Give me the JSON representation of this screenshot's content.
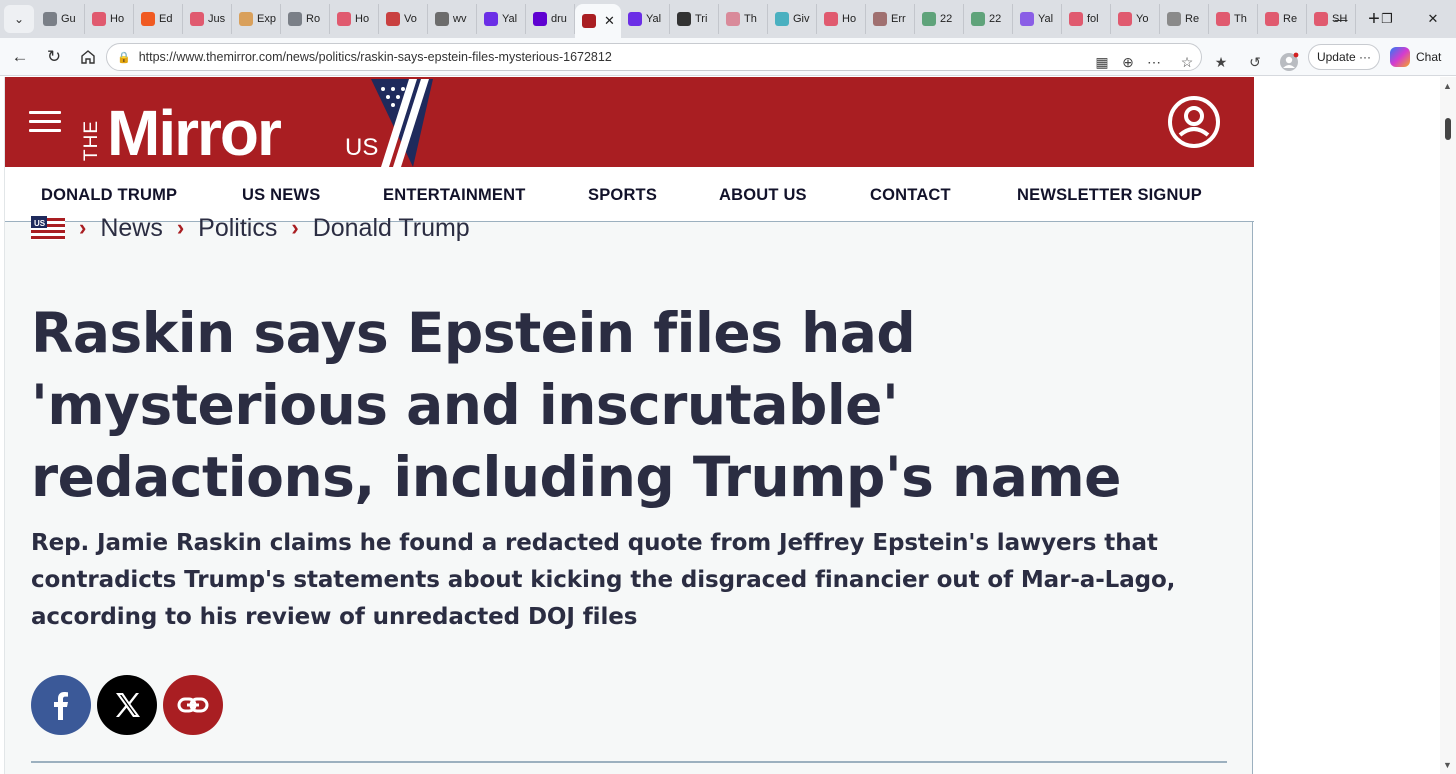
{
  "browser": {
    "tabs": [
      {
        "label": "Gu",
        "color": "#7a7f87"
      },
      {
        "label": "Ho",
        "color": "#e05a6f"
      },
      {
        "label": "Ed",
        "color": "#f05a22"
      },
      {
        "label": "Jus",
        "color": "#e05a6f"
      },
      {
        "label": "Exp",
        "color": "#d9a05b"
      },
      {
        "label": "Ro",
        "color": "#7a7f87"
      },
      {
        "label": "Ho",
        "color": "#e05a6f"
      },
      {
        "label": "Vo",
        "color": "#c94040"
      },
      {
        "label": "wv",
        "color": "#6c6c6c"
      },
      {
        "label": "Yal",
        "color": "#6b2ee6"
      },
      {
        "label": "dru",
        "color": "#5f01d1"
      },
      {
        "label": "",
        "color": "#a91e22",
        "active": true
      },
      {
        "label": "Yal",
        "color": "#6b2ee6"
      },
      {
        "label": "Tri",
        "color": "#333333"
      },
      {
        "label": "Th",
        "color": "#d98a9a"
      },
      {
        "label": "Giv",
        "color": "#4ab0c0"
      },
      {
        "label": "Ho",
        "color": "#e05a6f"
      },
      {
        "label": "Err",
        "color": "#a07070"
      },
      {
        "label": "22",
        "color": "#5fa37a"
      },
      {
        "label": "22",
        "color": "#5fa37a"
      },
      {
        "label": "Yal",
        "color": "#8a5ee6"
      },
      {
        "label": "fol",
        "color": "#e05a6f"
      },
      {
        "label": "Yo",
        "color": "#e05a6f"
      },
      {
        "label": "Re",
        "color": "#8a8a8a"
      },
      {
        "label": "Th",
        "color": "#e05a6f"
      },
      {
        "label": "Re",
        "color": "#e05a6f"
      },
      {
        "label": "SH",
        "color": "#e05a6f"
      }
    ],
    "url": "https://www.themirror.com/news/politics/raskin-says-epstein-files-mysterious-1672812",
    "update_label": "Update",
    "update_more": "···",
    "copilot_label": "Chat"
  },
  "site": {
    "brand_color": "#a91e22",
    "logo_the": "THE",
    "logo_mirror": "Mirror",
    "logo_us": "US",
    "nav": [
      "DONALD TRUMP",
      "US NEWS",
      "ENTERTAINMENT",
      "SPORTS",
      "ABOUT US",
      "CONTACT",
      "NEWSLETTER SIGNUP"
    ],
    "breadcrumb_flag": "US",
    "breadcrumbs": [
      "News",
      "Politics",
      "Donald Trump"
    ]
  },
  "article": {
    "headline": "Raskin says Epstein files had 'mysterious and inscrutable' redactions, including Trump's name",
    "standfirst": "Rep. Jamie Raskin claims he found a redacted quote from Jeffrey Epstein's lawyers that contradicts Trump's statements about kicking the disgraced financier out of Mar-a-Lago, according to his review of unredacted DOJ files",
    "share": [
      {
        "name": "facebook",
        "color": "#3b5998"
      },
      {
        "name": "x",
        "color": "#000000"
      },
      {
        "name": "copy-link",
        "color": "#a91e22"
      }
    ]
  }
}
